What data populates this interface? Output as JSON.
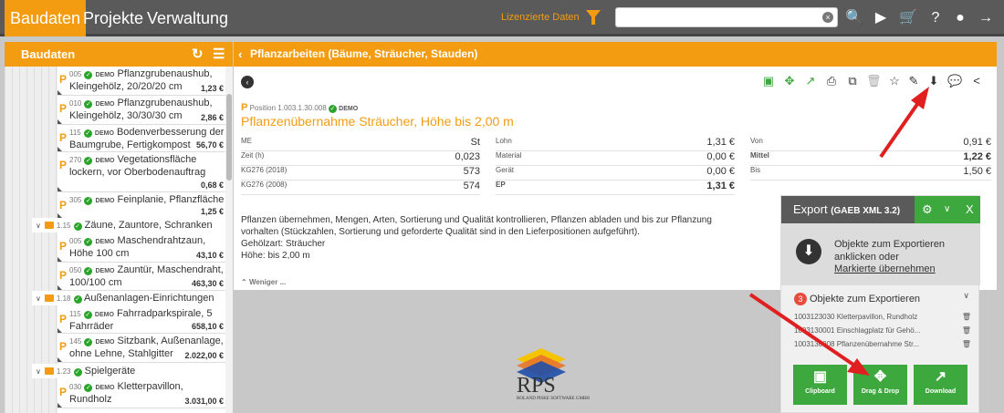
{
  "topnav": {
    "baudaten": "Baudaten",
    "projekte": "Projekte",
    "verwaltung": "Verwaltung",
    "licensed": "Lizenzierte Daten"
  },
  "search": {
    "placeholder": ""
  },
  "left": {
    "title": "Baudaten",
    "items": [
      {
        "num": "005",
        "demo": "DEMO",
        "text1": "Pflanzgrubenaushub,",
        "text2": "Kleingehölz, 20/20/20 cm",
        "price": "1,23 €"
      },
      {
        "num": "010",
        "demo": "DEMO",
        "text1": "Pflanzgrubenaushub,",
        "text2": "Kleingehölz, 30/30/30 cm",
        "price": "2,86 €"
      },
      {
        "num": "115",
        "demo": "DEMO",
        "text1": "Bodenverbesserung der",
        "text2": "Baumgrube, Fertigkompost",
        "price": "56,70 €"
      },
      {
        "num": "270",
        "demo": "DEMO",
        "text1": "Vegetationsfläche",
        "text2": "lockern, vor Oberbodenauftrag",
        "price": "0,68 €"
      },
      {
        "num": "305",
        "demo": "DEMO",
        "text1": "Feinplanie, Pflanzfläche",
        "text2": "",
        "price": "1,25 €"
      },
      {
        "num": "005",
        "demo": "DEMO",
        "text1": "Maschendrahtzaun,",
        "text2": "Höhe 100 cm",
        "price": "43,10 €"
      },
      {
        "num": "050",
        "demo": "DEMO",
        "text1": "Zauntür, Maschendraht,",
        "text2": "100/100 cm",
        "price": "463,30 €"
      },
      {
        "num": "115",
        "demo": "DEMO",
        "text1": "Fahrradparkspirale, 5",
        "text2": "Fahrräder",
        "price": "658,10 €"
      },
      {
        "num": "145",
        "demo": "DEMO",
        "text1": "Sitzbank, Außenanlage,",
        "text2": "ohne Lehne, Stahlgitter",
        "price": "2.022,00 €"
      },
      {
        "num": "030",
        "demo": "DEMO",
        "text1": "Kletterpavillon,",
        "text2": "Rundholz",
        "price": "3.031,00 €"
      }
    ],
    "groups": [
      {
        "num": "1.15",
        "label": "Zäune, Zauntore, Schranken"
      },
      {
        "num": "1.18",
        "label": "Außenanlagen-Einrichtungen"
      },
      {
        "num": "1.23",
        "label": "Spielgeräte"
      }
    ]
  },
  "main": {
    "header": "Pflanzarbeiten (Bäume, Sträucher, Stauden)",
    "position_label": "Position",
    "position_num": "1.003.1.30.008",
    "demo": "DEMO",
    "title": "Pflanzenübernahme Sträucher, Höhe bis 2,00 m",
    "col1": [
      {
        "k": "ME",
        "v": "St"
      },
      {
        "k": "Zeit (h)",
        "v": "0,023"
      },
      {
        "k": "KG276 (2018)",
        "v": "573"
      },
      {
        "k": "KG276 (2008)",
        "v": "574"
      }
    ],
    "col2": [
      {
        "k": "Lohn",
        "v": "1,31 €"
      },
      {
        "k": "Material",
        "v": "0,00 €"
      },
      {
        "k": "Gerät",
        "v": "0,00 €"
      },
      {
        "k": "EP",
        "v": "1,31 €"
      }
    ],
    "col3": [
      {
        "k": "Von",
        "v": "0,91 €"
      },
      {
        "k": "Mittel",
        "v": "1,22 €"
      },
      {
        "k": "Bis",
        "v": "1,50 €"
      }
    ],
    "desc1": "Pflanzen übernehmen, Mengen, Arten, Sortierung und Qualität kontrollieren, Pflanzen abladen und bis zur Pflanzung vorhalten (Stückzahlen, Sortierung und geforderte Qualität sind in den Lieferpositionen aufgeführt).",
    "desc2": "Gehölzart: Sträucher",
    "desc3": "Höhe: bis 2,00 m",
    "less": "Weniger ..."
  },
  "logo": {
    "name": "RPS",
    "sub": "ROLAND PISKE SOFTWARE GMBH"
  },
  "export": {
    "title": "Export",
    "format": "(GAEB XML 3.2)",
    "close": "X",
    "info1": "Objekte zum Exportieren anklicken oder",
    "info2": "Markierte übernehmen",
    "count": "3",
    "count_label": "Objekte zum Exportieren",
    "items": [
      "1003123030 Kletterpavillon, Rundholz",
      "1003130001 Einschlagplatz für Gehö...",
      "1003130008 Pflanzenübernahme Str..."
    ],
    "buttons": {
      "clipboard": "Clipboard",
      "dragdrop": "Drag & Drop",
      "download": "Download"
    }
  }
}
